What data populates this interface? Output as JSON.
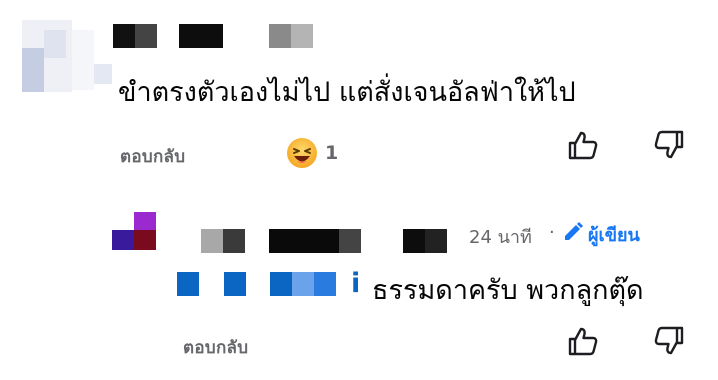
{
  "comments": [
    {
      "text": "ขำตรงตัวเองไม่ไป แต่สั่งเจนอัลฟ่าให้ไป",
      "reply_label": "ตอบกลับ",
      "reaction": {
        "icon": "laughing-emoji-icon",
        "count": "1"
      },
      "like_icon": "thumbs-up-icon",
      "dislike_icon": "thumbs-down-icon"
    },
    {
      "time": "24 นาที",
      "separator": "·",
      "author_label": "ผู้เขียน",
      "author_icon": "pencil-icon",
      "mention_tail": "i",
      "text": "ธรรมดาครับ พวกลูกตุ๊ด",
      "reply_label": "ตอบกลับ",
      "like_icon": "thumbs-up-icon",
      "dislike_icon": "thumbs-down-icon"
    }
  ],
  "colors": {
    "reply_text": "#65676b",
    "mention_blue": "#0a66c2",
    "author_blue": "#1877f2"
  }
}
